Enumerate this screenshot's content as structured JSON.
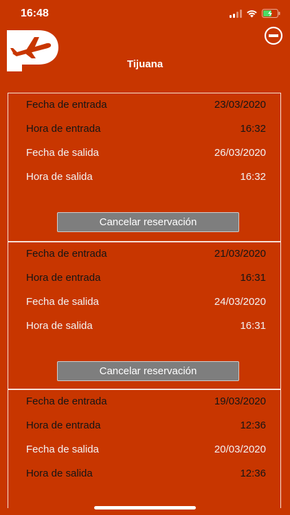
{
  "status": {
    "time": "16:48",
    "signal_icon": "signal-icon",
    "wifi_icon": "wifi-icon",
    "battery_icon": "battery-charging-icon"
  },
  "header": {
    "logo_icon": "parking-airplane-logo",
    "minus_icon": "minus-circle-icon",
    "title": "Tijuana"
  },
  "colors": {
    "background": "#c83600",
    "button": "#7e7e7e"
  },
  "reservations": [
    {
      "entry_date_label": "Fecha de entrada",
      "entry_date": "23/03/2020",
      "entry_time_label": "Hora de entrada",
      "entry_time": "16:32",
      "exit_date_label": "Fecha de salida",
      "exit_date": "26/03/2020",
      "exit_time_label": "Hora de salida",
      "exit_time": "16:32",
      "cancel_label": "Cancelar reservación"
    },
    {
      "entry_date_label": "Fecha de entrada",
      "entry_date": "21/03/2020",
      "entry_time_label": "Hora de entrada",
      "entry_time": "16:31",
      "exit_date_label": "Fecha de salida",
      "exit_date": "24/03/2020",
      "exit_time_label": "Hora de salida",
      "exit_time": "16:31",
      "cancel_label": "Cancelar reservación"
    },
    {
      "entry_date_label": "Fecha de entrada",
      "entry_date": "19/03/2020",
      "entry_time_label": "Hora de entrada",
      "entry_time": "12:36",
      "exit_date_label": "Fecha de salida",
      "exit_date": "20/03/2020",
      "exit_time_label": "Hora de salida",
      "exit_time": "12:36"
    }
  ]
}
